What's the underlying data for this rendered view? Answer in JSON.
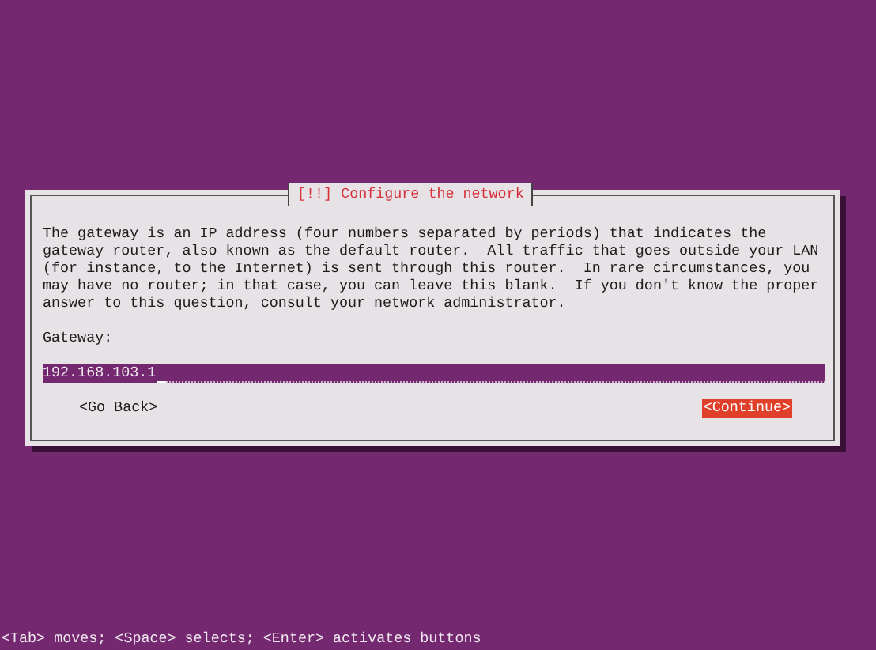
{
  "dialog": {
    "title": "[!!] Configure the network",
    "message": "The gateway is an IP address (four numbers separated by periods) that indicates the\ngateway router, also known as the default router.  All traffic that goes outside your LAN\n(for instance, to the Internet) is sent through this router.  In rare circumstances, you\nmay have no router; in that case, you can leave this blank.  If you don't know the proper\nanswer to this question, consult your network administrator.",
    "field": {
      "label": "Gateway:",
      "value": "192.168.103.1"
    },
    "buttons": [
      {
        "label": "<Go Back>",
        "selected": false
      },
      {
        "label": "<Continue>",
        "selected": true
      }
    ]
  },
  "status_bar": "<Tab> moves; <Space> selects; <Enter> activates buttons"
}
